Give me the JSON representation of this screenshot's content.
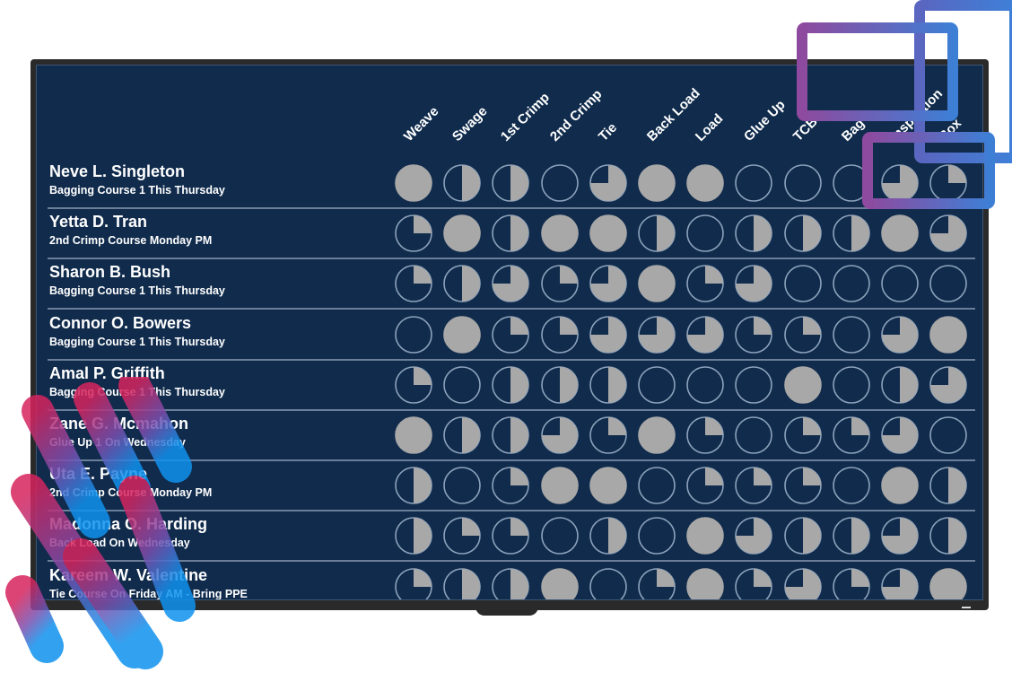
{
  "colors": {
    "screen_bg": "#102b4c",
    "pie_fill": "#a8a8a8",
    "pie_outline": "#8da2bb",
    "row_divider": "#6b7f98"
  },
  "columns": [
    "Weave",
    "Swage",
    "1st Crimp",
    "2nd Crimp",
    "Tie",
    "Back Load",
    "Load",
    "Glue Up",
    "TCB",
    "Bag",
    "Inspection",
    "Box"
  ],
  "trainees": [
    {
      "name": "Neve L. Singleton",
      "course": "Bagging Course 1 This Thursday",
      "progress": [
        100,
        50,
        50,
        0,
        75,
        100,
        100,
        0,
        0,
        0,
        75,
        25
      ]
    },
    {
      "name": "Yetta D. Tran",
      "course": "2nd Crimp Course Monday PM",
      "progress": [
        25,
        100,
        50,
        100,
        100,
        50,
        0,
        50,
        50,
        50,
        100,
        75
      ]
    },
    {
      "name": "Sharon B. Bush",
      "course": "Bagging Course 1 This Thursday",
      "progress": [
        25,
        50,
        75,
        25,
        75,
        100,
        25,
        75,
        0,
        0,
        0,
        0
      ]
    },
    {
      "name": "Connor O. Bowers",
      "course": "Bagging Course 1 This Thursday",
      "progress": [
        0,
        100,
        25,
        25,
        75,
        75,
        75,
        25,
        25,
        0,
        75,
        100
      ]
    },
    {
      "name": "Amal P. Griffith",
      "course": "Bagging Course 1 This Thursday",
      "progress": [
        25,
        0,
        50,
        50,
        50,
        0,
        0,
        0,
        100,
        0,
        50,
        75
      ]
    },
    {
      "name": "Zane G. Mcmahon",
      "course": "Glue Up 1 On Wednesday",
      "progress": [
        100,
        50,
        50,
        75,
        25,
        100,
        25,
        0,
        25,
        25,
        75,
        0
      ]
    },
    {
      "name": "Uta E. Payne",
      "course": "2nd Crimp Course Monday PM",
      "progress": [
        50,
        0,
        25,
        100,
        100,
        0,
        25,
        25,
        25,
        0,
        100,
        50
      ]
    },
    {
      "name": "Madonna O. Harding",
      "course": "Back Load On Wednesday",
      "progress": [
        50,
        25,
        25,
        0,
        50,
        0,
        100,
        75,
        50,
        50,
        75,
        50
      ]
    },
    {
      "name": "Kareem W. Valentine",
      "course": "Tie Course On Friday AM - Bring PPE",
      "progress": [
        25,
        50,
        50,
        100,
        0,
        25,
        100,
        25,
        75,
        25,
        75,
        100
      ]
    }
  ]
}
